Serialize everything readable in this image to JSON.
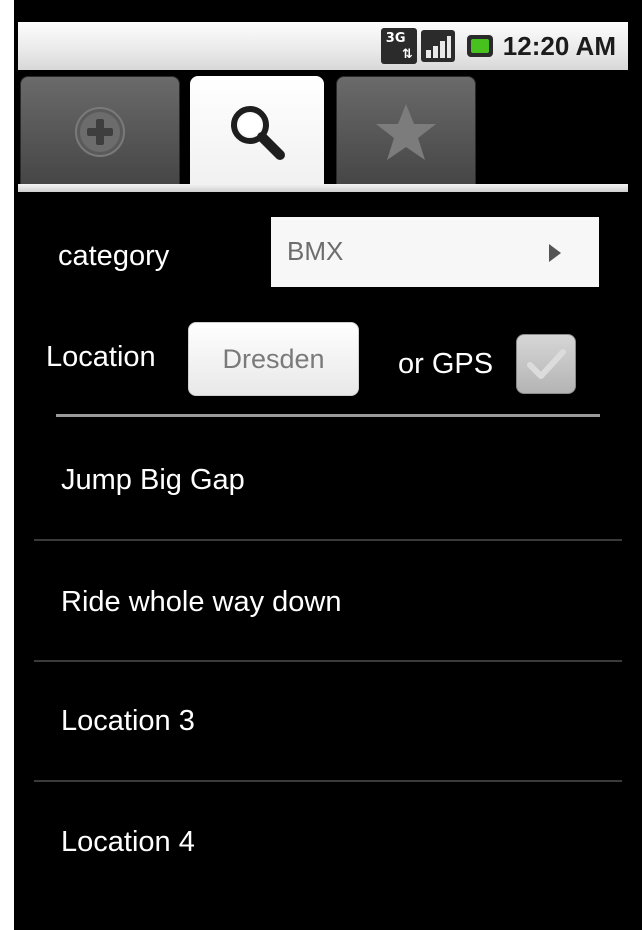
{
  "status_bar": {
    "network_type": "3G",
    "time": "12:20 AM",
    "icons": [
      "3g-network-icon",
      "signal-strength-icon",
      "battery-icon"
    ]
  },
  "tabs": [
    {
      "name": "add-tab",
      "icon": "add-circle-icon",
      "selected": false
    },
    {
      "name": "search-tab",
      "icon": "search-icon",
      "selected": true
    },
    {
      "name": "favorites-tab",
      "icon": "star-icon",
      "selected": false
    }
  ],
  "form": {
    "category_label": "category",
    "category_value": "BMX",
    "location_label": "Location",
    "location_value": "Dresden",
    "gps_label": "or GPS",
    "gps_checked": true
  },
  "results": [
    {
      "label": "Jump Big Gap"
    },
    {
      "label": "Ride whole way down"
    },
    {
      "label": "Location 3"
    },
    {
      "label": "Location 4"
    }
  ],
  "colors": {
    "background": "#000000",
    "text": "#ffffff",
    "accent_green": "#46c11d"
  }
}
